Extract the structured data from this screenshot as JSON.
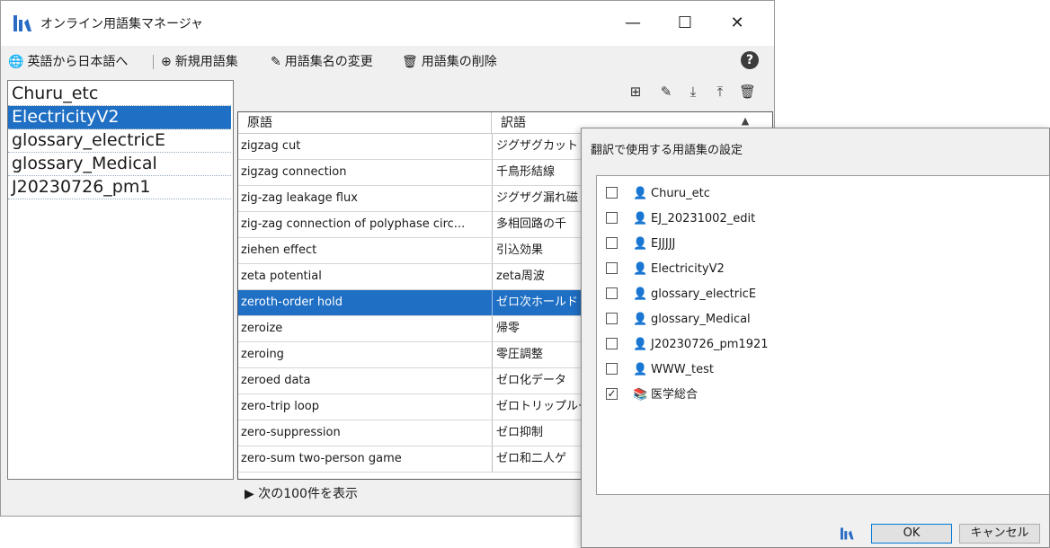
{
  "window": {
    "title": "オンライン用語集マネージャ",
    "minimize": "—",
    "maximize": "☐",
    "close": "✕"
  },
  "menu": {
    "en_to_ja": "英語から日本語へ",
    "new_glossary": "新規用語集",
    "rename_glossary": "用語集名の変更",
    "delete_glossary": "用語集の削除",
    "help": "?"
  },
  "glossaries": [
    "Churu_etc",
    "ElectricityV2",
    "glossary_electricE",
    "glossary_Medical",
    "J20230726_pm1"
  ],
  "selected_glossary": "ElectricityV2",
  "table": {
    "headers": [
      "原語",
      "訳語"
    ],
    "rows": [
      [
        "zigzag cut",
        "ジグザグカット"
      ],
      [
        "zigzag connection",
        "千鳥形結線"
      ],
      [
        "zig-zag leakage flux",
        "ジグザグ漏れ磁"
      ],
      [
        "zig-zag connection of polyphase circ...",
        "多相回路の千"
      ],
      [
        "ziehen effect",
        "引込効果"
      ],
      [
        "zeta potential",
        "zeta周波"
      ],
      [
        "zeroth-order hold",
        "ゼロ次ホールド"
      ],
      [
        "zeroize",
        "帰零"
      ],
      [
        "zeroing",
        "零圧調整"
      ],
      [
        "zeroed data",
        "ゼロ化データ"
      ],
      [
        "zero-trip loop",
        "ゼロトリップルー"
      ],
      [
        "zero-suppression",
        "ゼロ抑制"
      ],
      [
        "zero-sum two-person game",
        "ゼロ和二人ゲ"
      ]
    ],
    "selected_row": 6
  },
  "show_next": "▶ 次の100件を表示",
  "dialog": {
    "title": "翻訳で使用する用語集の設定",
    "items": [
      {
        "label": "Churu_etc",
        "checked": false,
        "icon": "user-icon"
      },
      {
        "label": "EJ_20231002_edit",
        "checked": false,
        "icon": "user-icon"
      },
      {
        "label": "EJJJJJ",
        "checked": false,
        "icon": "user-icon"
      },
      {
        "label": "ElectricityV2",
        "checked": false,
        "icon": "user-icon"
      },
      {
        "label": "glossary_electricE",
        "checked": false,
        "icon": "user-icon"
      },
      {
        "label": "glossary_Medical",
        "checked": false,
        "icon": "user-icon"
      },
      {
        "label": "J20230726_pm1921",
        "checked": false,
        "icon": "user-icon"
      },
      {
        "label": "WWW_test",
        "checked": false,
        "icon": "user-icon"
      },
      {
        "label": "医学総合",
        "checked": true,
        "icon": "book-stack-icon"
      }
    ],
    "ok": "OK",
    "cancel": "キャンセル"
  },
  "colors": {
    "selection": "#1f6fc4",
    "logo": "#2a6cc4"
  }
}
